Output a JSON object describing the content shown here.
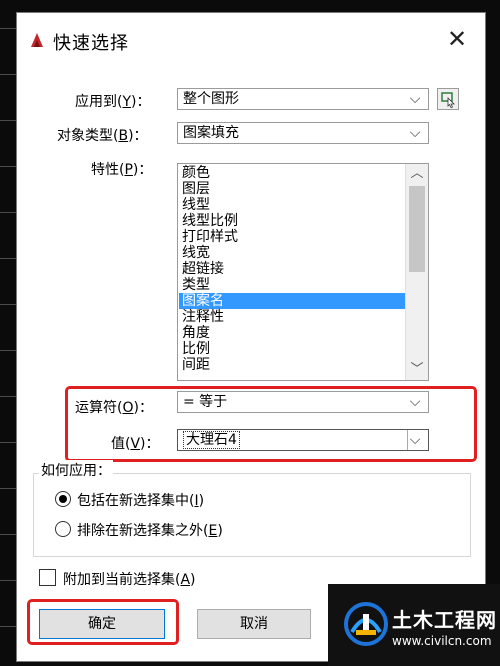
{
  "dialog": {
    "title": "快速选择",
    "close_glyph": "✕"
  },
  "fields": {
    "apply_to": {
      "label_pre": "应用到(",
      "label_key": "Y",
      "label_post": ")：",
      "value": "整个图形"
    },
    "object_type": {
      "label_pre": "对象类型(",
      "label_key": "B",
      "label_post": ")：",
      "value": "图案填充"
    },
    "properties": {
      "label_pre": "特性(",
      "label_key": "P",
      "label_post": ")："
    },
    "operator": {
      "label_pre": "运算符(",
      "label_key": "O",
      "label_post": ")：",
      "value": "= 等于"
    },
    "value": {
      "label_pre": "值(",
      "label_key": "V",
      "label_post": ")：",
      "value": "大理石4"
    }
  },
  "properties_list": [
    "颜色",
    "图层",
    "线型",
    "线型比例",
    "打印样式",
    "线宽",
    "超链接",
    "类型",
    "图案名",
    "注释性",
    "角度",
    "比例",
    "间距"
  ],
  "selected_property_index": 8,
  "how_to_apply": {
    "legend": "如何应用：",
    "include": {
      "pre": "包括在新选择集中(",
      "key": "I",
      "post": ")"
    },
    "exclude": {
      "pre": "排除在新选择集之外(",
      "key": "E",
      "post": ")"
    }
  },
  "append": {
    "pre": "附加到当前选择集(",
    "key": "A",
    "post": ")"
  },
  "buttons": {
    "ok": "确定",
    "cancel": "取消"
  },
  "watermark": {
    "title": "土木工程网",
    "url": "www.civilcn.com"
  },
  "colors": {
    "highlight": "#e02020",
    "selection": "#3399ff"
  },
  "icons": {
    "app": "autocad-icon",
    "pick": "pick-objects-icon"
  }
}
